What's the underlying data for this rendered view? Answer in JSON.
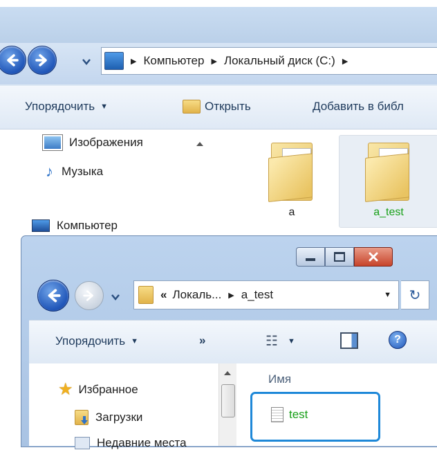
{
  "back_window": {
    "address": {
      "crumbs": [
        "Компьютер",
        "Локальный диск (C:)"
      ]
    },
    "toolbar": {
      "organize_label": "Упорядочить",
      "open_label": "Открыть",
      "add_label": "Добавить в библ"
    },
    "sidebar": {
      "items": [
        {
          "label": "Изображения",
          "icon": "pictures-icon"
        },
        {
          "label": "Музыка",
          "icon": "music-icon"
        },
        {
          "label": "Компьютер",
          "icon": "computer-icon"
        }
      ]
    },
    "files": [
      {
        "name": "a",
        "icon": "folder-icon"
      },
      {
        "name": "a_test",
        "icon": "folder-icon",
        "selected": true
      }
    ]
  },
  "front_window": {
    "address": {
      "overflow": "«",
      "crumbs": [
        "Локаль...",
        "a_test"
      ]
    },
    "toolbar": {
      "organize_label": "Упорядочить",
      "more_label": "»"
    },
    "sidebar": {
      "items": [
        {
          "label": "Избранное",
          "icon": "star-icon"
        },
        {
          "label": "Загрузки",
          "icon": "downloads-icon"
        },
        {
          "label": "Недавние места",
          "icon": "recent-places-icon"
        }
      ]
    },
    "column_header": "Имя",
    "files": [
      {
        "name": "test",
        "icon": "text-file-icon",
        "selected": true
      }
    ]
  },
  "colors": {
    "selected_text": "#18a018",
    "highlight_border": "#1e88d8",
    "close_button": "#c7432a"
  }
}
